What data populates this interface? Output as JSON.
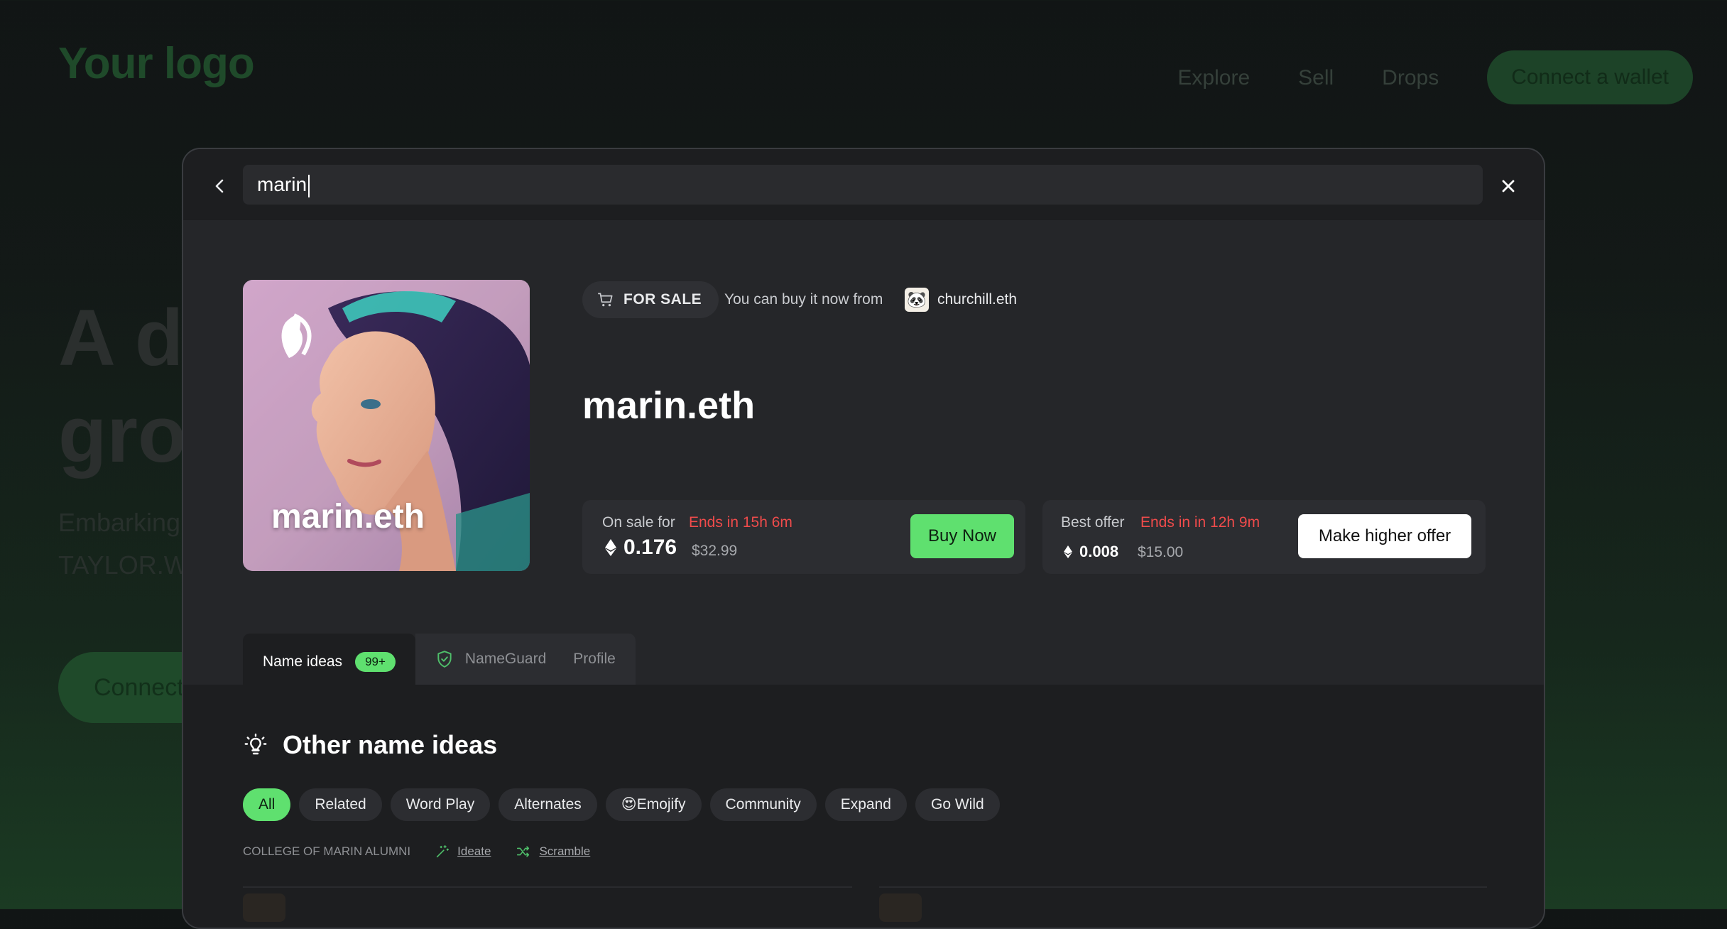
{
  "background": {
    "logo": "Your logo",
    "nav": [
      "Explore",
      "Sell",
      "Drops"
    ],
    "connect_label": "Connect a wallet",
    "hero_line1": "A d",
    "hero_line2": "gro",
    "sub_line1": "Embarking",
    "sub_line2": "TAYLOR.W",
    "cta_label": "Connect"
  },
  "search": {
    "value": "marin"
  },
  "domain": {
    "name": "marin.eth",
    "avatar_label": "marin.eth"
  },
  "sale_header": {
    "badge": "FOR SALE",
    "text": "You can buy it now from",
    "seller": "churchill.eth"
  },
  "on_sale": {
    "label": "On sale for",
    "ends": "Ends in 15h 6m",
    "eth": "0.176",
    "usd": "$32.99",
    "button": "Buy Now"
  },
  "best_offer": {
    "label": "Best offer",
    "ends": "Ends in in 12h 9m",
    "eth": "0.008",
    "usd": "$15.00",
    "button": "Make higher offer"
  },
  "tabs": {
    "name_ideas": "Name ideas",
    "count": "99+",
    "nameguard": "NameGuard",
    "profile": "Profile"
  },
  "ideas": {
    "heading": "Other name ideas",
    "chips": [
      "All",
      "Related",
      "Word Play",
      "Alternates",
      "Emojify",
      "Community",
      "Expand",
      "Go Wild"
    ],
    "emojify_emoji": "😍",
    "meta_label": "COLLEGE OF MARIN ALUMNI",
    "ideate": "Ideate",
    "scramble": "Scramble"
  },
  "colors": {
    "accent_green": "#5fe06f",
    "ends_red": "#ef4b4b",
    "modal_bg": "#252629"
  }
}
